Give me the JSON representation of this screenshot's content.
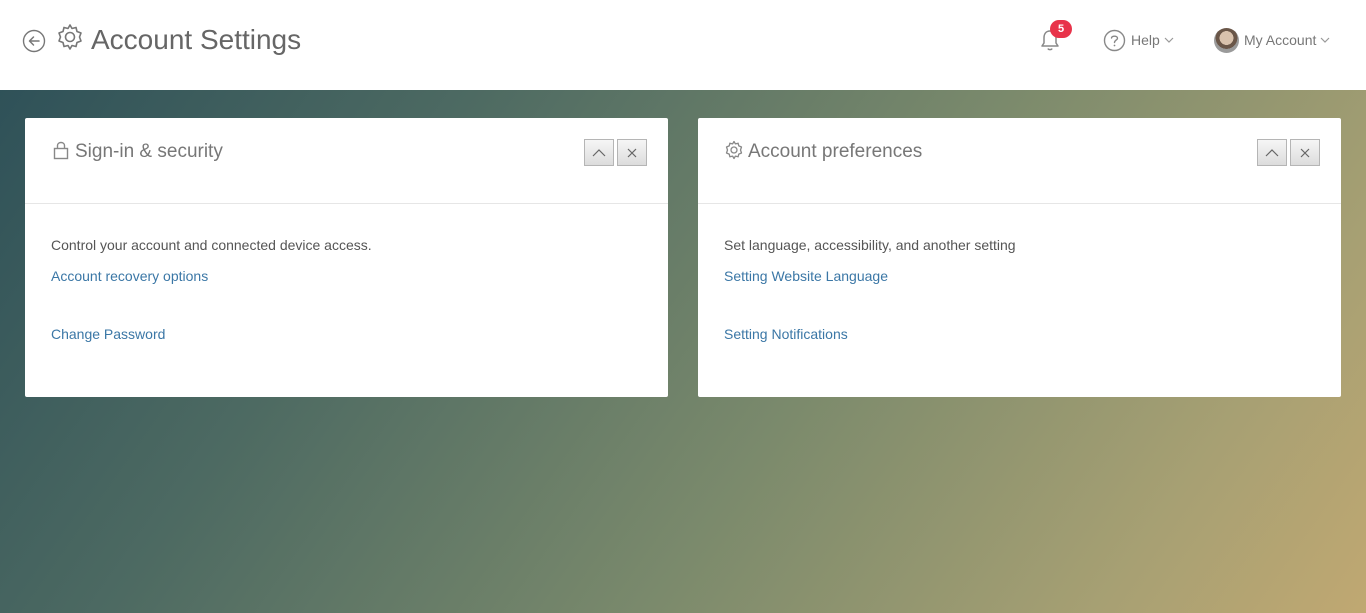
{
  "header": {
    "title": "Account Settings",
    "notification_count": "5",
    "help_label": "Help",
    "account_label": "My Account"
  },
  "panels": [
    {
      "title": "Sign-in & security",
      "icon": "lock-icon",
      "description": "Control your account and connected device access.",
      "links": [
        "Account recovery options",
        "Change Password"
      ]
    },
    {
      "title": "Account preferences",
      "icon": "gear-icon",
      "description": "Set language, accessibility, and another setting",
      "links": [
        "Setting Website Language",
        "Setting Notifications"
      ]
    }
  ],
  "colors": {
    "badge": "#e8334a",
    "link": "#3b77a6"
  }
}
